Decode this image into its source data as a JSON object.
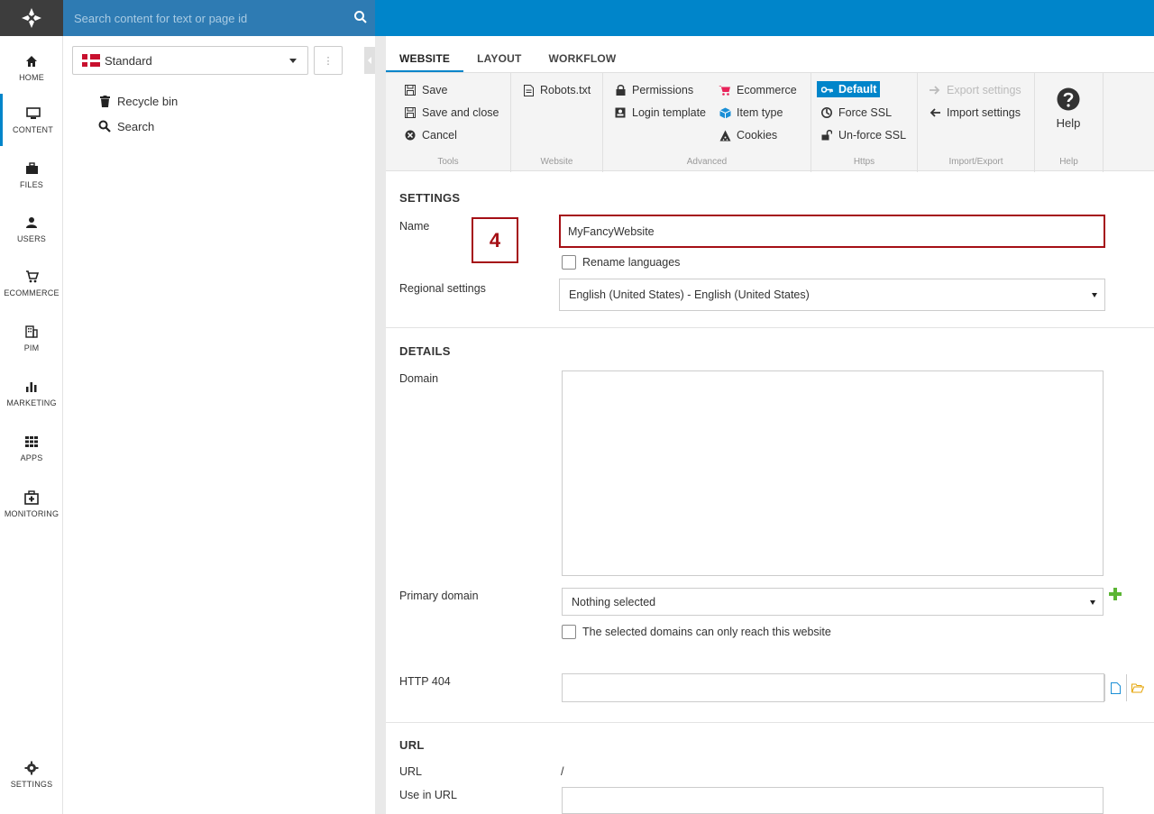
{
  "search": {
    "placeholder": "Search content for text or page id"
  },
  "nav": {
    "items": [
      {
        "label": "HOME",
        "icon": "home-icon"
      },
      {
        "label": "CONTENT",
        "icon": "monitor-icon"
      },
      {
        "label": "FILES",
        "icon": "briefcase-icon"
      },
      {
        "label": "USERS",
        "icon": "user-icon"
      },
      {
        "label": "ECOMMERCE",
        "icon": "cart-icon"
      },
      {
        "label": "PIM",
        "icon": "building-icon"
      },
      {
        "label": "MARKETING",
        "icon": "bar-chart-icon"
      },
      {
        "label": "APPS",
        "icon": "grid-icon"
      },
      {
        "label": "MONITORING",
        "icon": "medkit-icon"
      }
    ],
    "settings_label": "SETTINGS"
  },
  "tree": {
    "selected": "Standard",
    "menu_glyph": "⋮",
    "items": [
      {
        "label": "Recycle bin",
        "icon": "trash-icon"
      },
      {
        "label": "Search",
        "icon": "search-icon"
      }
    ]
  },
  "tabs": [
    "WEBSITE",
    "LAYOUT",
    "WORKFLOW"
  ],
  "ribbon": {
    "tools": {
      "title": "Tools",
      "save": "Save",
      "save_close": "Save and close",
      "cancel": "Cancel"
    },
    "website": {
      "title": "Website",
      "robots": "Robots.txt"
    },
    "advanced": {
      "title": "Advanced",
      "permissions": "Permissions",
      "login_template": "Login template",
      "ecommerce": "Ecommerce",
      "item_type": "Item type",
      "cookies": "Cookies"
    },
    "https": {
      "title": "Https",
      "default": "Default",
      "force_ssl": "Force SSL",
      "unforce_ssl": "Un-force SSL"
    },
    "import_export": {
      "title": "Import/Export",
      "export": "Export settings",
      "import": "Import settings"
    },
    "help": {
      "title": "Help",
      "label": "Help"
    }
  },
  "settings": {
    "title": "SETTINGS",
    "name_label": "Name",
    "name_value": "MyFancyWebsite",
    "rename_languages": "Rename languages",
    "regional_label": "Regional settings",
    "regional_value": "English (United States) - English (United States)",
    "step_badge": "4"
  },
  "details": {
    "title": "DETAILS",
    "domain_label": "Domain",
    "primary_domain_label": "Primary domain",
    "primary_domain_value": "Nothing selected",
    "only_reach": "The selected domains can only reach this website",
    "http404_label": "HTTP 404"
  },
  "url": {
    "title": "URL",
    "url_label": "URL",
    "url_value": "/",
    "use_in_url_label": "Use in URL"
  },
  "colors": {
    "accent": "#0085ca",
    "highlight_red": "#a50f15"
  }
}
